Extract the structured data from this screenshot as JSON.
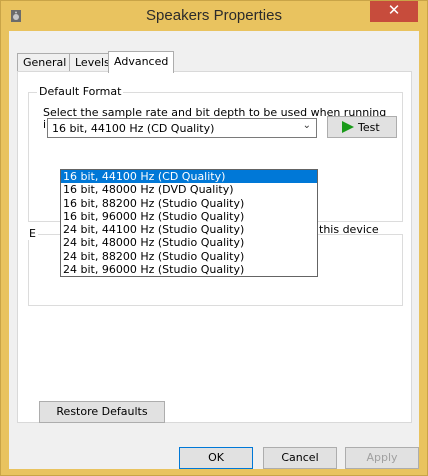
{
  "window": {
    "title": "Speakers Properties",
    "close_glyph": "✕",
    "app_icon": "speaker-icon"
  },
  "tabs": [
    {
      "label": "General",
      "active": false
    },
    {
      "label": "Levels",
      "active": false
    },
    {
      "label": "Advanced",
      "active": true
    }
  ],
  "default_format": {
    "group_label": "Default Format",
    "description": "Select the sample rate and bit depth to be used when running in shared mode.",
    "selected_value": "16 bit, 44100 Hz (CD Quality)",
    "options": [
      "16 bit, 44100 Hz (CD Quality)",
      "16 bit, 48000 Hz (DVD Quality)",
      "16 bit, 88200 Hz (Studio Quality)",
      "16 bit, 96000 Hz (Studio Quality)",
      "24 bit, 44100 Hz (Studio Quality)",
      "24 bit, 48000 Hz (Studio Quality)",
      "24 bit, 88200 Hz (Studio Quality)",
      "24 bit, 96000 Hz (Studio Quality)"
    ],
    "test_label": "Test",
    "test_icon": "play-icon"
  },
  "exclusive_mode": {
    "group_label_fragment": "E",
    "text_fragment": "this device"
  },
  "buttons": {
    "restore_defaults": "Restore Defaults",
    "ok": "OK",
    "cancel": "Cancel",
    "apply": "Apply"
  },
  "colors": {
    "title_bar": "#e9c35f",
    "close_button": "#c74c3c",
    "selection": "#0078d7",
    "test_arrow": "#1a9a1a"
  }
}
